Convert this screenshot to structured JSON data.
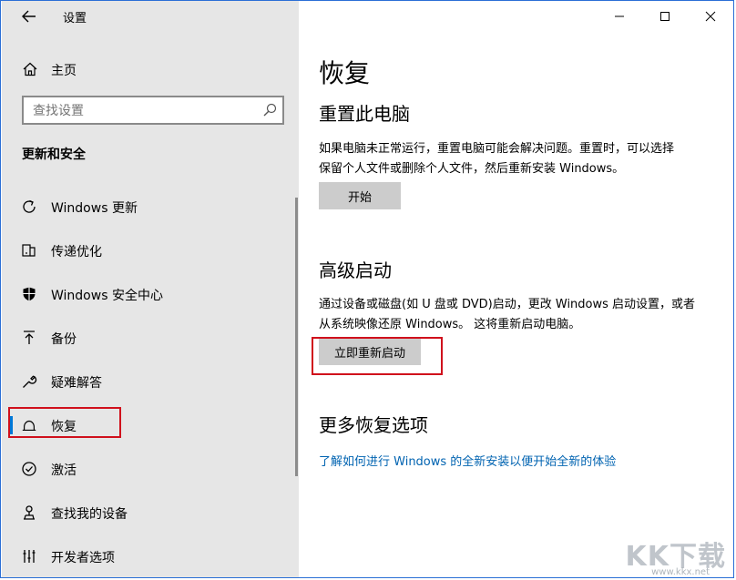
{
  "window": {
    "title": "设置",
    "controls": {
      "minimize": "minimize-icon",
      "maximize": "maximize-icon",
      "close": "close-icon"
    }
  },
  "sidebar": {
    "home_label": "主页",
    "search": {
      "placeholder": "查找设置"
    },
    "section_title": "更新和安全",
    "items": [
      {
        "label": "Windows 更新",
        "icon": "refresh-icon"
      },
      {
        "label": "传递优化",
        "icon": "delivery-optimization-icon"
      },
      {
        "label": "Windows 安全中心",
        "icon": "shield-icon"
      },
      {
        "label": "备份",
        "icon": "backup-upload-icon"
      },
      {
        "label": "疑难解答",
        "icon": "wrench-icon"
      },
      {
        "label": "恢复",
        "icon": "recovery-icon",
        "selected": true
      },
      {
        "label": "激活",
        "icon": "activation-check-icon"
      },
      {
        "label": "查找我的设备",
        "icon": "find-device-icon"
      },
      {
        "label": "开发者选项",
        "icon": "developer-tools-icon"
      }
    ]
  },
  "main": {
    "title": "恢复",
    "reset": {
      "heading": "重置此电脑",
      "line1": "如果电脑未正常运行，重置电脑可能会解决问题。重置时，可以选择",
      "line2": "保留个人文件或删除个人文件，然后重新安装 Windows。",
      "button": "开始"
    },
    "advanced": {
      "heading": "高级启动",
      "line1": "通过设备或磁盘(如 U 盘或 DVD)启动，更改 Windows 启动设置，或者",
      "line2": "从系统映像还原 Windows。 这将重新启动电脑。",
      "button": "立即重新启动"
    },
    "more": {
      "heading": "更多恢复选项",
      "link": "了解如何进行 Windows 的全新安装以便开始全新的体验"
    }
  },
  "watermark": {
    "text": "KK下载",
    "url": "www.kkx.net"
  },
  "colors": {
    "sidebar_bg": "#e6e6e6",
    "accent": "#0078d7",
    "link": "#0063b1",
    "highlight": "#d0101c",
    "button_bg": "#cccccc"
  }
}
